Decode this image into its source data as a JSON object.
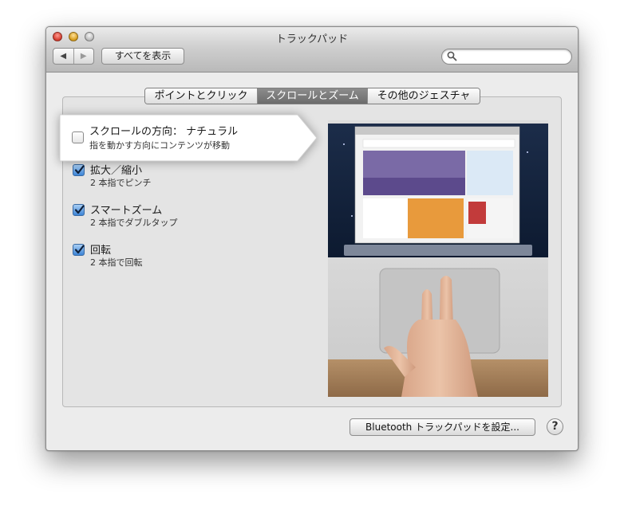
{
  "window": {
    "title": "トラックパッド"
  },
  "toolbar": {
    "back_glyph": "◀",
    "forward_glyph": "▶",
    "show_all_label": "すべてを表示",
    "search_value": ""
  },
  "tabs": [
    {
      "label": "ポイントとクリック",
      "active": false
    },
    {
      "label": "スクロールとズーム",
      "active": true
    },
    {
      "label": "その他のジェスチャ",
      "active": false
    }
  ],
  "options": [
    {
      "title": "スクロールの方向： ナチュラル",
      "subtitle": "指を動かす方向にコンテンツが移動",
      "checked": false
    },
    {
      "title": "拡大／縮小",
      "subtitle": "2 本指でピンチ",
      "checked": true
    },
    {
      "title": "スマートズーム",
      "subtitle": "2 本指でダブルタップ",
      "checked": true
    },
    {
      "title": "回転",
      "subtitle": "2 本指で回転",
      "checked": true
    }
  ],
  "preview": {
    "icon": "trackpad-gesture-video"
  },
  "footer": {
    "bluetooth_button_label": "Bluetooth トラックパッドを設定...",
    "help_label": "?"
  },
  "colors": {
    "active_tab": "#7a7a7a",
    "checkbox_checked": "#3c84d6",
    "window_bg": "#ececec"
  }
}
